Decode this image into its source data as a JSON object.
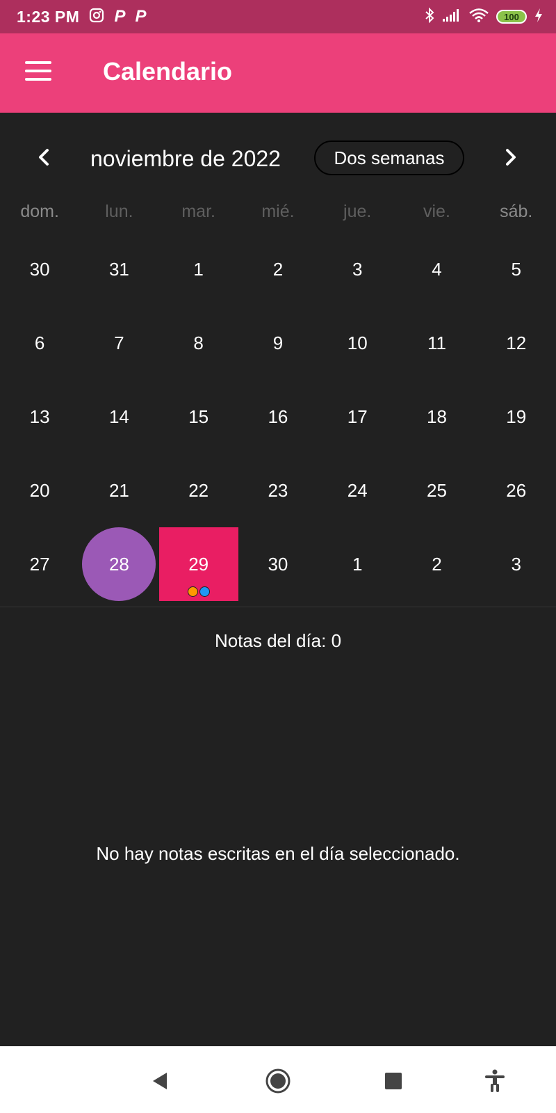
{
  "status_bar": {
    "time": "1:23 PM",
    "left_icons": [
      "instagram-icon",
      "p-icon",
      "p-icon"
    ],
    "right_icons": [
      "bluetooth-icon",
      "signal-icon",
      "wifi-icon",
      "battery-icon",
      "charging-icon"
    ],
    "battery_level": "100"
  },
  "app_bar": {
    "title": "Calendario",
    "menu_icon": "hamburger-menu-icon",
    "background": "#ec407a"
  },
  "calendar": {
    "month_title": "noviembre de 2022",
    "format_button": "Dos semanas",
    "weekdays": [
      "dom.",
      "lun.",
      "mar.",
      "mié.",
      "jue.",
      "vie.",
      "sáb."
    ],
    "weeks": [
      [
        "30",
        "31",
        "1",
        "2",
        "3",
        "4",
        "5"
      ],
      [
        "6",
        "7",
        "8",
        "9",
        "10",
        "11",
        "12"
      ],
      [
        "13",
        "14",
        "15",
        "16",
        "17",
        "18",
        "19"
      ],
      [
        "20",
        "21",
        "22",
        "23",
        "24",
        "25",
        "26"
      ],
      [
        "27",
        "28",
        "29",
        "30",
        "1",
        "2",
        "3"
      ]
    ],
    "today": {
      "week": 4,
      "day": 1,
      "color": "#9b59b6"
    },
    "selected": {
      "week": 4,
      "day": 2,
      "color": "#e91e63"
    },
    "event_markers": [
      {
        "week": 4,
        "day": 2,
        "colors": [
          "#ff9800",
          "#2196f3"
        ]
      }
    ]
  },
  "notes": {
    "count_label": "Notas del día: 0",
    "empty_message": "No hay notas escritas en el día seleccionado."
  },
  "nav_bar": {
    "items": [
      "back-icon",
      "home-icon",
      "recents-icon",
      "accessibility-icon"
    ]
  }
}
